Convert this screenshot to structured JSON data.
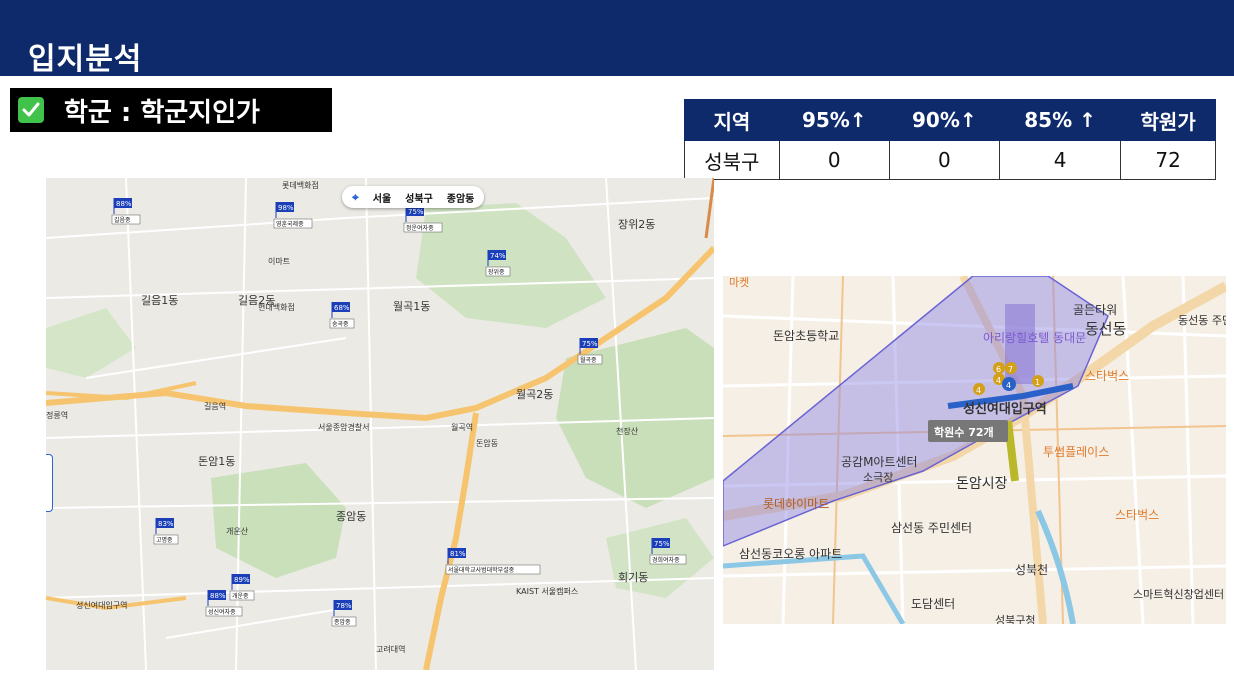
{
  "header": {
    "title": "입지분석"
  },
  "section": {
    "title": "학군 : 학군지인가"
  },
  "table": {
    "headers": [
      "지역",
      "95%↑",
      "90%↑",
      "85% ↑",
      "학원가"
    ],
    "row": [
      "성북구",
      "0",
      "0",
      "4",
      "72"
    ]
  },
  "map1": {
    "location_bar": {
      "target_icon": "crosshair-icon",
      "items": [
        "서울",
        "성북구",
        "종암동"
      ]
    },
    "schools": [
      {
        "rate": "88%",
        "name": "길음중"
      },
      {
        "rate": "98%",
        "name": "영훈국제중"
      },
      {
        "rate": "75%",
        "name": "정운여자중"
      },
      {
        "rate": "74%",
        "name": "장위중"
      },
      {
        "rate": "68%",
        "name": "숭곡중"
      },
      {
        "rate": "75%",
        "name": "월곡중"
      },
      {
        "rate": "83%",
        "name": "고명중"
      },
      {
        "rate": "81%",
        "name": "서울대학교사범대학부설중"
      },
      {
        "rate": "75%",
        "name": "경희여자중"
      },
      {
        "rate": "89%",
        "name": "개운중"
      },
      {
        "rate": "88%",
        "name": "성신여자중"
      },
      {
        "rate": "78%",
        "name": "종암중"
      }
    ],
    "labels": [
      "길음1동",
      "길음2동",
      "월곡1동",
      "월곡2동",
      "장위2동",
      "돈암1동",
      "종암동",
      "회기동",
      "길음역",
      "월곡역",
      "고려대역",
      "성신여대입구역",
      "정릉역",
      "돈암동",
      "개운산",
      "천장산",
      "이마트",
      "롯데백화점",
      "현대백화점",
      "서울종암경찰서",
      "KAIST 서울캠퍼스"
    ]
  },
  "map2": {
    "labels": [
      "돈암초등학교",
      "아리랑힐호텔 동대문",
      "골든타워",
      "동선동",
      "동선동 주민센터",
      "스타벅스",
      "성신여대입구역",
      "학원수 72개",
      "공감M아트센터",
      "소극장",
      "투썸플레이스",
      "돈암시장",
      "롯데하이마트",
      "삼선동 주민센터",
      "삼선동코오롱 아파트",
      "성북천",
      "도담센터",
      "스마트혁신창업센터",
      "성북구청",
      "마켓"
    ],
    "route_badges": [
      "4",
      "6",
      "7",
      "4",
      "1",
      "4"
    ]
  },
  "colors": {
    "navy": "#0e2a6b",
    "check_green": "#41c24b",
    "flag_blue": "#1a3fb8",
    "zone_purple": "#8c86e6"
  }
}
